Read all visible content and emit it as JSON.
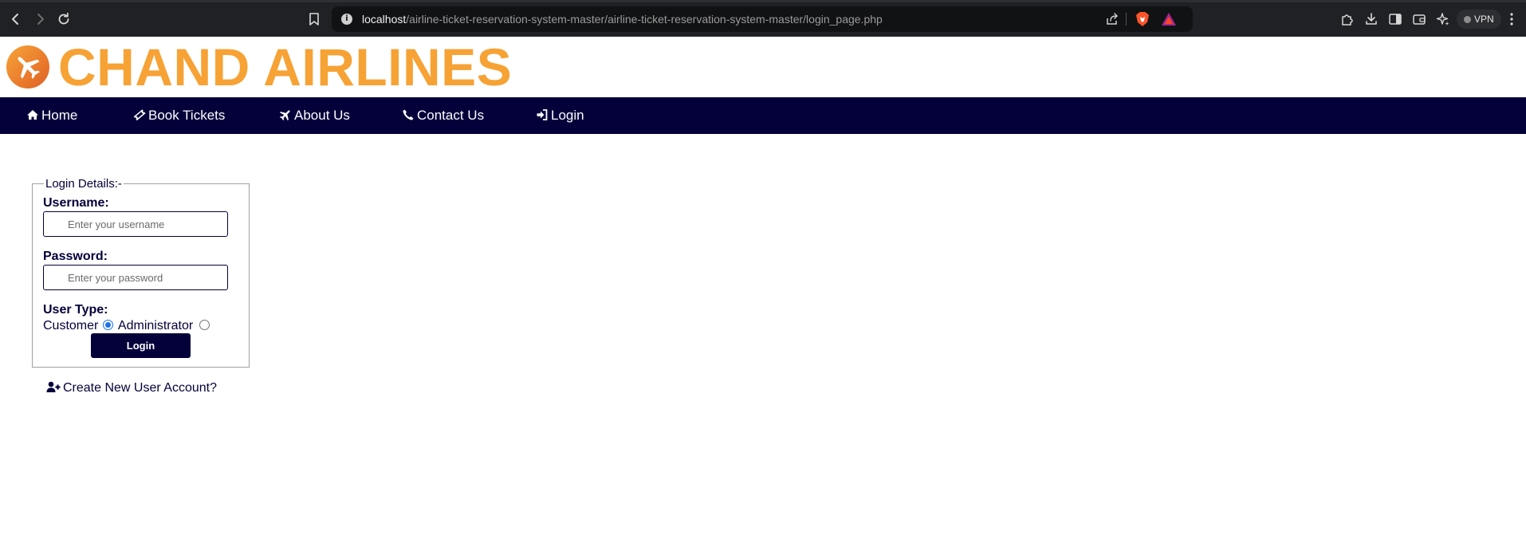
{
  "browser": {
    "url_host": "localhost",
    "url_path": "/airline-ticket-reservation-system-master/airline-ticket-reservation-system-master/login_page.php",
    "vpn_label": "VPN"
  },
  "header": {
    "site_title": "CHAND AIRLINES"
  },
  "nav": {
    "items": [
      {
        "label": "Home",
        "icon": "home-icon"
      },
      {
        "label": "Book Tickets",
        "icon": "ticket-icon"
      },
      {
        "label": "About Us",
        "icon": "plane-icon"
      },
      {
        "label": "Contact Us",
        "icon": "phone-icon"
      },
      {
        "label": "Login",
        "icon": "sign-in-icon"
      }
    ]
  },
  "login_form": {
    "legend": "Login Details:-",
    "username_label": "Username:",
    "username_placeholder": "Enter your username",
    "username_value": "",
    "password_label": "Password:",
    "password_placeholder": "Enter your password",
    "password_value": "",
    "user_type_label": "User Type:",
    "user_types": [
      {
        "label": "Customer",
        "selected": true
      },
      {
        "label": "Administrator",
        "selected": false
      }
    ],
    "submit_label": "Login"
  },
  "create_account": {
    "label": "Create New User Account?",
    "icon": "user-plus-icon"
  },
  "colors": {
    "brand_orange": "#f7a235",
    "nav_navy": "#03003a",
    "radio_accent": "#1a73e8"
  }
}
